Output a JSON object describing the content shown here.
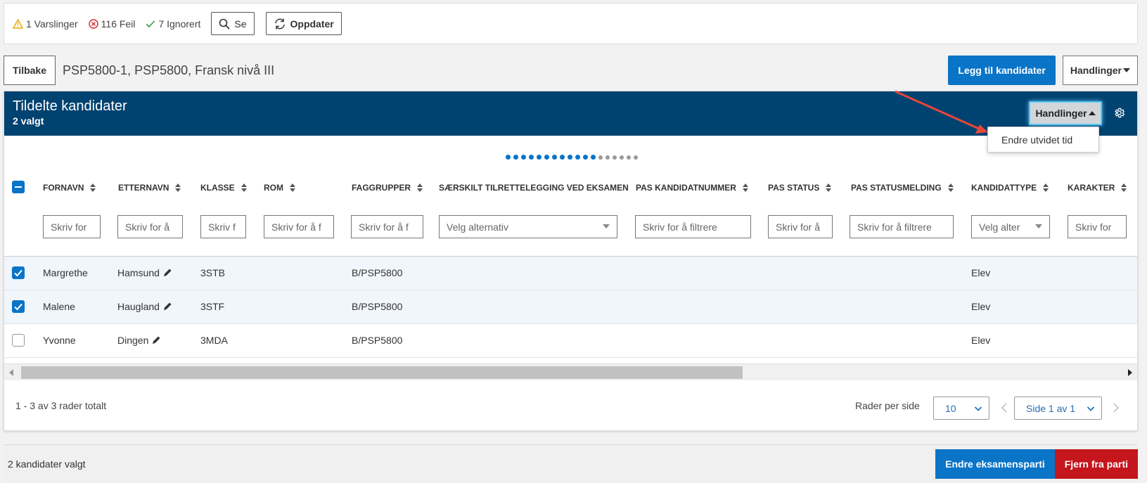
{
  "status": {
    "warnings": "1 Varslinger",
    "errors": "116 Feil",
    "ignored": "7 Ignorert",
    "see_label": "Se",
    "refresh_label": "Oppdater"
  },
  "header": {
    "back_label": "Tilbake",
    "title": "PSP5800-1, PSP5800, Fransk nivå III",
    "add_candidates_label": "Legg til kandidater",
    "actions_label": "Handlinger"
  },
  "panel": {
    "title": "Tildelte kandidater",
    "subtitle": "2 valgt",
    "actions_label": "Handlinger",
    "dropdown_item": "Endre utvidet tid"
  },
  "columns": [
    {
      "label": "FORNAVN",
      "filter": "Skriv for"
    },
    {
      "label": "ETTERNAVN",
      "filter": "Skriv for å"
    },
    {
      "label": "KLASSE",
      "filter": "Skriv f"
    },
    {
      "label": "ROM",
      "filter": "Skriv for å f"
    },
    {
      "label": "FAGGRUPPER",
      "filter": "Skriv for å f"
    },
    {
      "label": "SÆRSKILT TILRETTELEGGING VED EKSAMEN",
      "filter": "Velg alternativ"
    },
    {
      "label": "PAS KANDIDATNUMMER",
      "filter": "Skriv for å filtrere"
    },
    {
      "label": "PAS STATUS",
      "filter": "Skriv for å"
    },
    {
      "label": "PAS STATUSMELDING",
      "filter": "Skriv for å filtrere"
    },
    {
      "label": "KANDIDATTYPE",
      "filter": "Velg alter"
    },
    {
      "label": "KARAKTER",
      "filter": "Skriv for"
    }
  ],
  "rows": [
    {
      "selected": true,
      "first": "Margrethe",
      "last": "Hamsund",
      "class": "3STB",
      "group": "B/PSP5800",
      "type": "Elev"
    },
    {
      "selected": true,
      "first": "Malene",
      "last": "Haugland",
      "class": "3STF",
      "group": "B/PSP5800",
      "type": "Elev"
    },
    {
      "selected": false,
      "first": "Yvonne",
      "last": "Dingen",
      "class": "3MDA",
      "group": "B/PSP5800",
      "type": "Elev"
    }
  ],
  "pagination": {
    "total": "1 - 3 av 3 rader totalt",
    "rows_per_page_label": "Rader per side",
    "rows_per_page": "10",
    "page": "Side 1 av 1"
  },
  "bottom": {
    "selected_text": "2 kandidater valgt",
    "change_party_label": "Endre eksamensparti",
    "remove_label": "Fjern fra parti"
  },
  "carousel": {
    "active_dots": 12,
    "inactive_dots": 6
  },
  "colors": {
    "primary": "#0a74c7",
    "header_bg": "#004270",
    "danger": "#c4161c",
    "warning": "#e6a700",
    "error": "#d9262c",
    "success": "#2e9e44",
    "arrow": "#e5473c"
  }
}
